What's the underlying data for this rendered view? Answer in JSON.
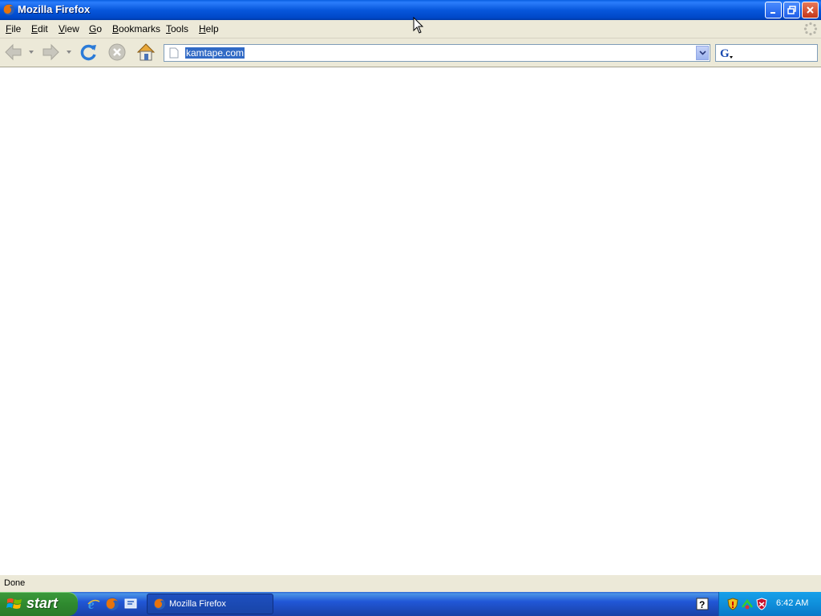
{
  "window": {
    "title": "Mozilla Firefox"
  },
  "menu": {
    "items": [
      {
        "accel": "F",
        "rest": "ile"
      },
      {
        "accel": "E",
        "rest": "dit"
      },
      {
        "accel": "V",
        "rest": "iew"
      },
      {
        "accel": "G",
        "rest": "o"
      },
      {
        "accel": "B",
        "rest": "ookmarks"
      },
      {
        "accel": "T",
        "rest": "ools"
      },
      {
        "accel": "H",
        "rest": "elp"
      }
    ]
  },
  "toolbar": {
    "url": "kamtape.com",
    "icons": [
      "back-icon",
      "forward-icon",
      "reload-icon",
      "stop-icon",
      "home-icon"
    ]
  },
  "status": {
    "text": "Done"
  },
  "taskbar": {
    "start_label": "start",
    "task_label": "Mozilla Firefox",
    "clock": "6:42 AM"
  }
}
